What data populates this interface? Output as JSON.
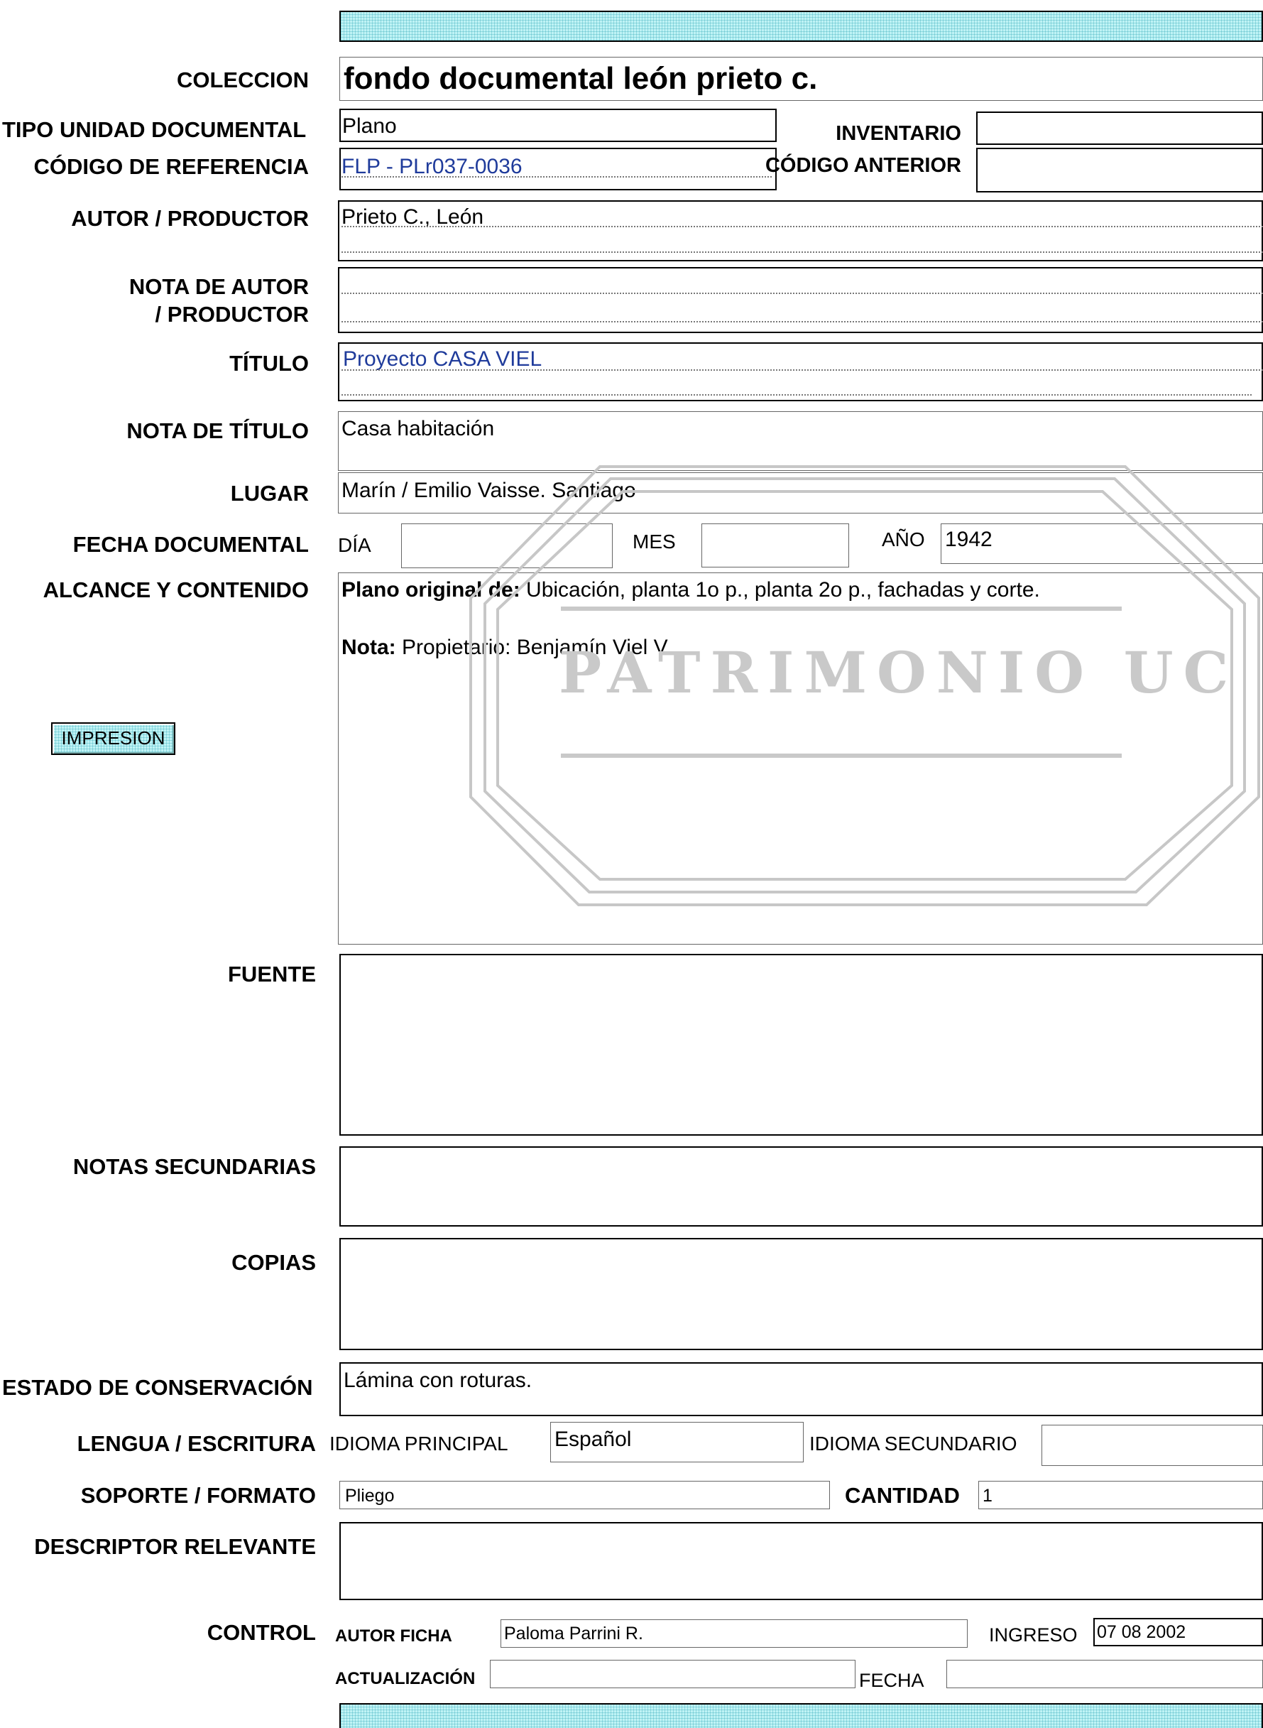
{
  "fields": {
    "coleccion": {
      "label": "COLECCION",
      "value": "fondo documental león prieto c."
    },
    "tipo": {
      "label": "TIPO UNIDAD DOCUMENTAL",
      "value": "Plano"
    },
    "inventario": {
      "label": "INVENTARIO",
      "value": ""
    },
    "codigo_ref": {
      "label": "CÓDIGO DE REFERENCIA",
      "value": "FLP - PLr037-0036"
    },
    "codigo_ant": {
      "label": "CÓDIGO ANTERIOR",
      "value": ""
    },
    "autor": {
      "label": "AUTOR / PRODUCTOR",
      "value": "Prieto C., León"
    },
    "nota_autor": {
      "label_line1": "NOTA DE AUTOR",
      "label_line2": "/ PRODUCTOR",
      "value": ""
    },
    "titulo": {
      "label": "TÍTULO",
      "value": "Proyecto CASA VIEL"
    },
    "nota_titulo": {
      "label": "NOTA DE TÍTULO",
      "value": "Casa habitación"
    },
    "lugar": {
      "label": "LUGAR",
      "value": "Marín / Emilio Vaisse. Santiago"
    },
    "fecha": {
      "label": "FECHA DOCUMENTAL",
      "dia_label": "DÍA",
      "dia": "",
      "mes_label": "MES",
      "mes": "",
      "anio_label": "AÑO",
      "anio": "1942"
    },
    "alcance": {
      "label": "ALCANCE Y CONTENIDO",
      "line1_bold": "Plano original de:",
      "line1_text": " Ubicación, planta 1o p., planta 2o p., fachadas y corte.",
      "line2_bold": "Nota:",
      "line2_text": " Propietario:  Benjamín Viel V."
    },
    "fuente": {
      "label": "FUENTE",
      "value": ""
    },
    "notas_sec": {
      "label": "NOTAS SECUNDARIAS",
      "value": ""
    },
    "copias": {
      "label": "COPIAS",
      "value": ""
    },
    "estado": {
      "label": "ESTADO DE CONSERVACIÓN",
      "value": "Lámina con roturas."
    },
    "lengua": {
      "label": "LENGUA / ESCRITURA",
      "principal_label": "IDIOMA PRINCIPAL",
      "principal": "Español",
      "secundario_label": "IDIOMA SECUNDARIO",
      "secundario": ""
    },
    "soporte": {
      "label": "SOPORTE / FORMATO",
      "value": "Pliego",
      "cantidad_label": "CANTIDAD",
      "cantidad": "1"
    },
    "descriptor": {
      "label": "DESCRIPTOR RELEVANTE",
      "value": ""
    },
    "control": {
      "label": "CONTROL",
      "autor_label": "AUTOR FICHA",
      "autor": "Paloma Parrini R.",
      "ingreso_label": "INGRESO",
      "ingreso": "07 08 2002",
      "act_label": "ACTUALIZACIÓN",
      "act": "",
      "fecha_label": "FECHA",
      "fecha": ""
    }
  },
  "buttons": {
    "impresion": "IMPRESION"
  },
  "watermark": {
    "text": "PATRIMONIO UC"
  },
  "colors": {
    "band": "#bff3f5",
    "link": "#1f3b9b",
    "watermark": "#c9c9c9"
  }
}
